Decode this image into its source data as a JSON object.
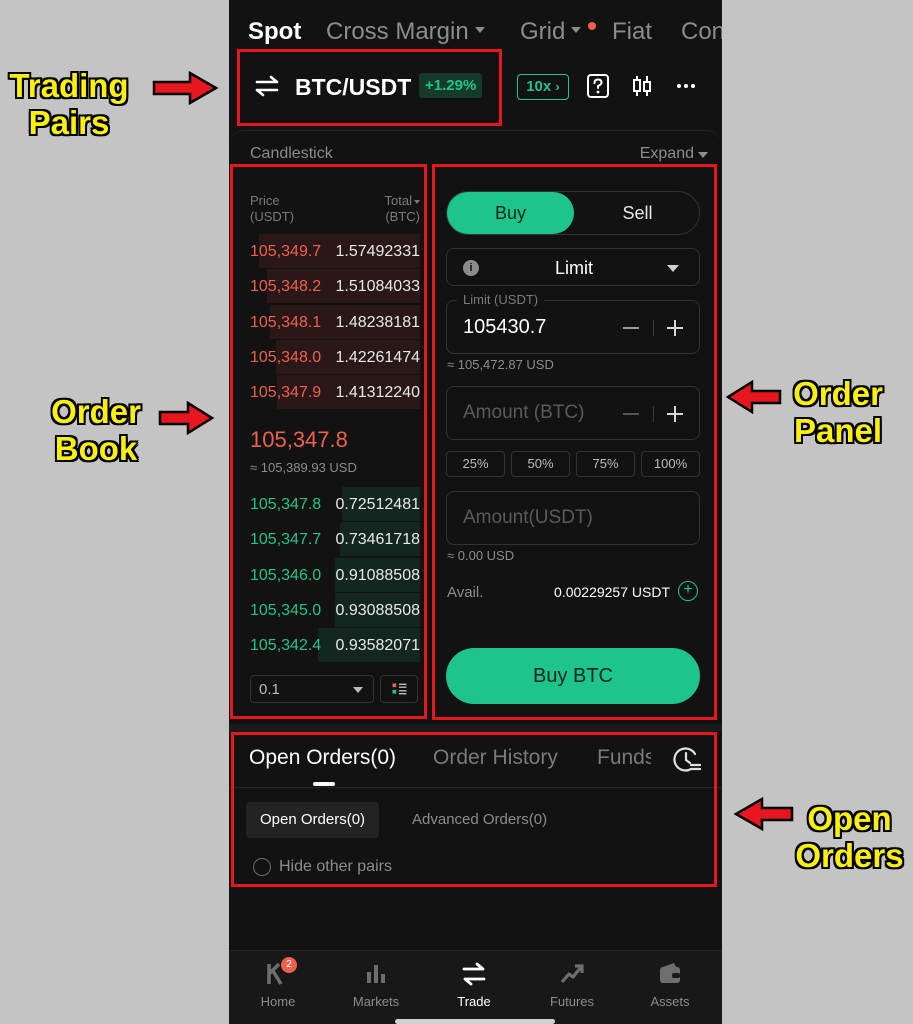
{
  "top_tabs": [
    {
      "label": "Spot",
      "active": true
    },
    {
      "label": "Cross Margin",
      "dropdown": true
    },
    {
      "label": "Grid",
      "dropdown": true,
      "dot": true
    },
    {
      "label": "Fiat"
    },
    {
      "label": "Con"
    }
  ],
  "pair": {
    "name": "BTC/USDT",
    "change": "+1.29%",
    "leverage": "10x"
  },
  "candlestick": {
    "label": "Candlestick",
    "expand": "Expand"
  },
  "order_book": {
    "price_header": "Price",
    "price_unit": "(USDT)",
    "total_header": "Total",
    "total_unit": "(BTC)",
    "asks": [
      {
        "price": "105,349.7",
        "qty": "1.57492331",
        "depth": 0.95
      },
      {
        "price": "105,348.2",
        "qty": "1.51084033",
        "depth": 0.9
      },
      {
        "price": "105,348.1",
        "qty": "1.48238181",
        "depth": 0.88
      },
      {
        "price": "105,348.0",
        "qty": "1.42261474",
        "depth": 0.85
      },
      {
        "price": "105,347.9",
        "qty": "1.41312240",
        "depth": 0.84
      }
    ],
    "last_price": "105,347.8",
    "last_price_usd": "≈ 105,389.93 USD",
    "bids": [
      {
        "price": "105,347.8",
        "qty": "0.72512481",
        "depth": 0.46
      },
      {
        "price": "105,347.7",
        "qty": "0.73461718",
        "depth": 0.47
      },
      {
        "price": "105,346.0",
        "qty": "0.91088508",
        "depth": 0.5
      },
      {
        "price": "105,345.0",
        "qty": "0.93088508",
        "depth": 0.5
      },
      {
        "price": "105,342.4",
        "qty": "0.93582071",
        "depth": 0.6
      }
    ],
    "depth": "0.1"
  },
  "order_panel": {
    "buy_label": "Buy",
    "sell_label": "Sell",
    "order_type": "Limit",
    "limit_legend": "Limit (USDT)",
    "limit_value": "105430.7",
    "limit_usd": "≈ 105,472.87 USD",
    "amount_placeholder": "Amount (BTC)",
    "percent_options": [
      "25%",
      "50%",
      "75%",
      "100%"
    ],
    "total_placeholder": "Amount(USDT)",
    "total_usd": "≈ 0.00 USD",
    "avail_label": "Avail.",
    "avail_value": "0.00229257 USDT",
    "submit_label": "Buy BTC"
  },
  "open_orders": {
    "tabs": [
      "Open Orders(0)",
      "Order History",
      "Funds"
    ],
    "sub_tabs": [
      "Open Orders(0)",
      "Advanced Orders(0)"
    ],
    "hide_label": "Hide other pairs"
  },
  "bottom_nav": [
    {
      "label": "Home",
      "icon": "home-icon",
      "badge": "2"
    },
    {
      "label": "Markets",
      "icon": "markets-icon"
    },
    {
      "label": "Trade",
      "icon": "trade-icon",
      "active": true
    },
    {
      "label": "Futures",
      "icon": "futures-icon"
    },
    {
      "label": "Assets",
      "icon": "assets-icon"
    }
  ],
  "annotations": {
    "trading_pairs": [
      "Trading",
      "Pairs"
    ],
    "order_book": [
      "Order",
      "Book"
    ],
    "order_panel": [
      "Order",
      "Panel"
    ],
    "open_orders": [
      "Open",
      "Orders"
    ]
  },
  "colors": {
    "accent_green": "#1dc58c",
    "ask_red": "#f0604c",
    "annotation_yellow": "#fbf00c",
    "annotation_red": "#e8161f"
  }
}
